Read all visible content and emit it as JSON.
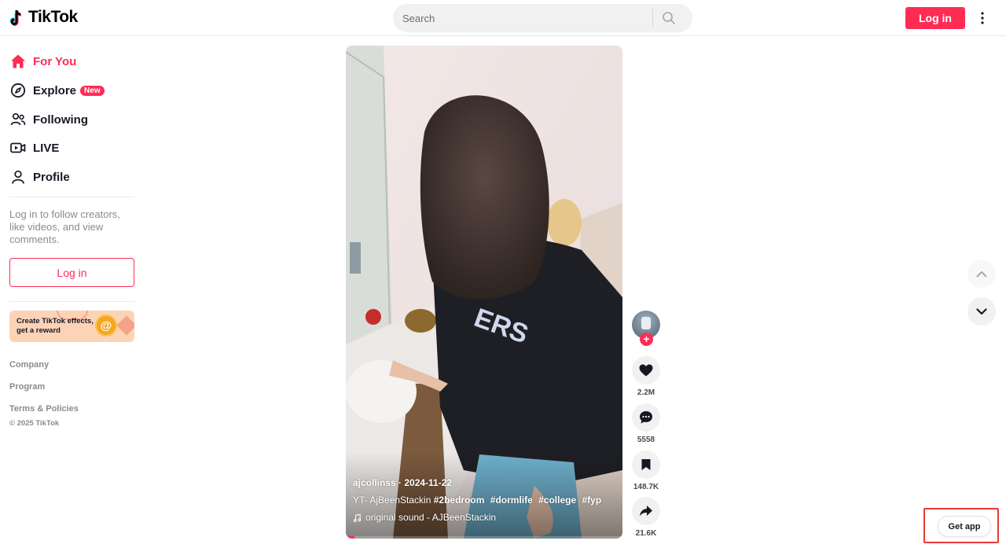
{
  "header": {
    "logo_text": "TikTok",
    "search_placeholder": "Search",
    "login_label": "Log in",
    "more_icon": "more-vertical-icon"
  },
  "sidebar": {
    "nav": [
      {
        "label": "For You",
        "icon": "home-icon",
        "active": true
      },
      {
        "label": "Explore",
        "icon": "compass-icon",
        "badge": "New"
      },
      {
        "label": "Following",
        "icon": "users-icon"
      },
      {
        "label": "LIVE",
        "icon": "live-camera-icon"
      },
      {
        "label": "Profile",
        "icon": "user-icon"
      }
    ],
    "login_prompt": "Log in to follow creators, like videos, and view comments.",
    "login_label": "Log in",
    "effects_banner": "Create TikTok effects, get a reward",
    "footer_links": [
      "Company",
      "Program",
      "Terms & Policies"
    ],
    "copyright": "© 2025 TikTok"
  },
  "video": {
    "author": "ajcollinss",
    "date": "2024-11-22",
    "author_line": "ajcollinss · 2024-11-22",
    "caption_prefix": "YT- AjBeenStackin",
    "hashtags": [
      "#2bedroom",
      "#dormlife",
      "#college",
      "#fyp"
    ],
    "sound": "original sound - AJBeenStackin",
    "progress_percent": 3
  },
  "actions": {
    "likes": "2.2M",
    "comments": "5558",
    "saves": "148.7K",
    "shares": "21.6K"
  },
  "get_app_label": "Get app",
  "colors": {
    "brand": "#fe2c55",
    "text": "#161823",
    "muted": "#8a8b91"
  }
}
